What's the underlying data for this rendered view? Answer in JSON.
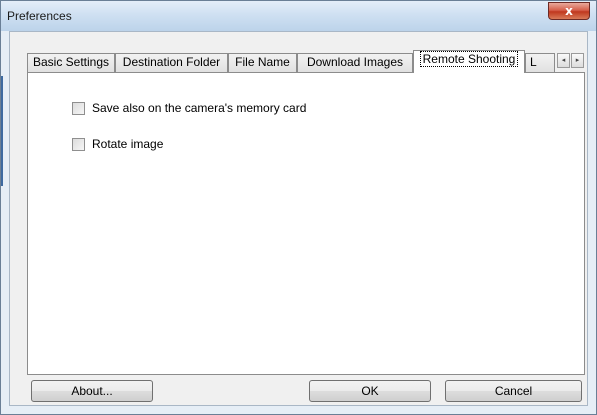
{
  "window": {
    "title": "Preferences",
    "close_symbol": "x"
  },
  "tabs": [
    {
      "label": "Basic Settings",
      "active": false
    },
    {
      "label": "Destination Folder",
      "active": false
    },
    {
      "label": "File Name",
      "active": false
    },
    {
      "label": "Download Images",
      "active": false
    },
    {
      "label": "Remote Shooting",
      "active": true
    },
    {
      "label": "L",
      "active": false
    }
  ],
  "tab_scroll": {
    "left_symbol": "◂",
    "right_symbol": "▸"
  },
  "panel": {
    "options": [
      {
        "label": "Save also on the camera's memory card",
        "checked": false
      },
      {
        "label": "Rotate image",
        "checked": false
      }
    ]
  },
  "buttons": {
    "about_label": "About...",
    "ok_label": "OK",
    "cancel_label": "Cancel"
  },
  "colors": {
    "titlebar": "#cfe0f2",
    "close_button": "#c94a36",
    "client_background": "#f0f0f0",
    "panel_background": "#ffffff"
  }
}
